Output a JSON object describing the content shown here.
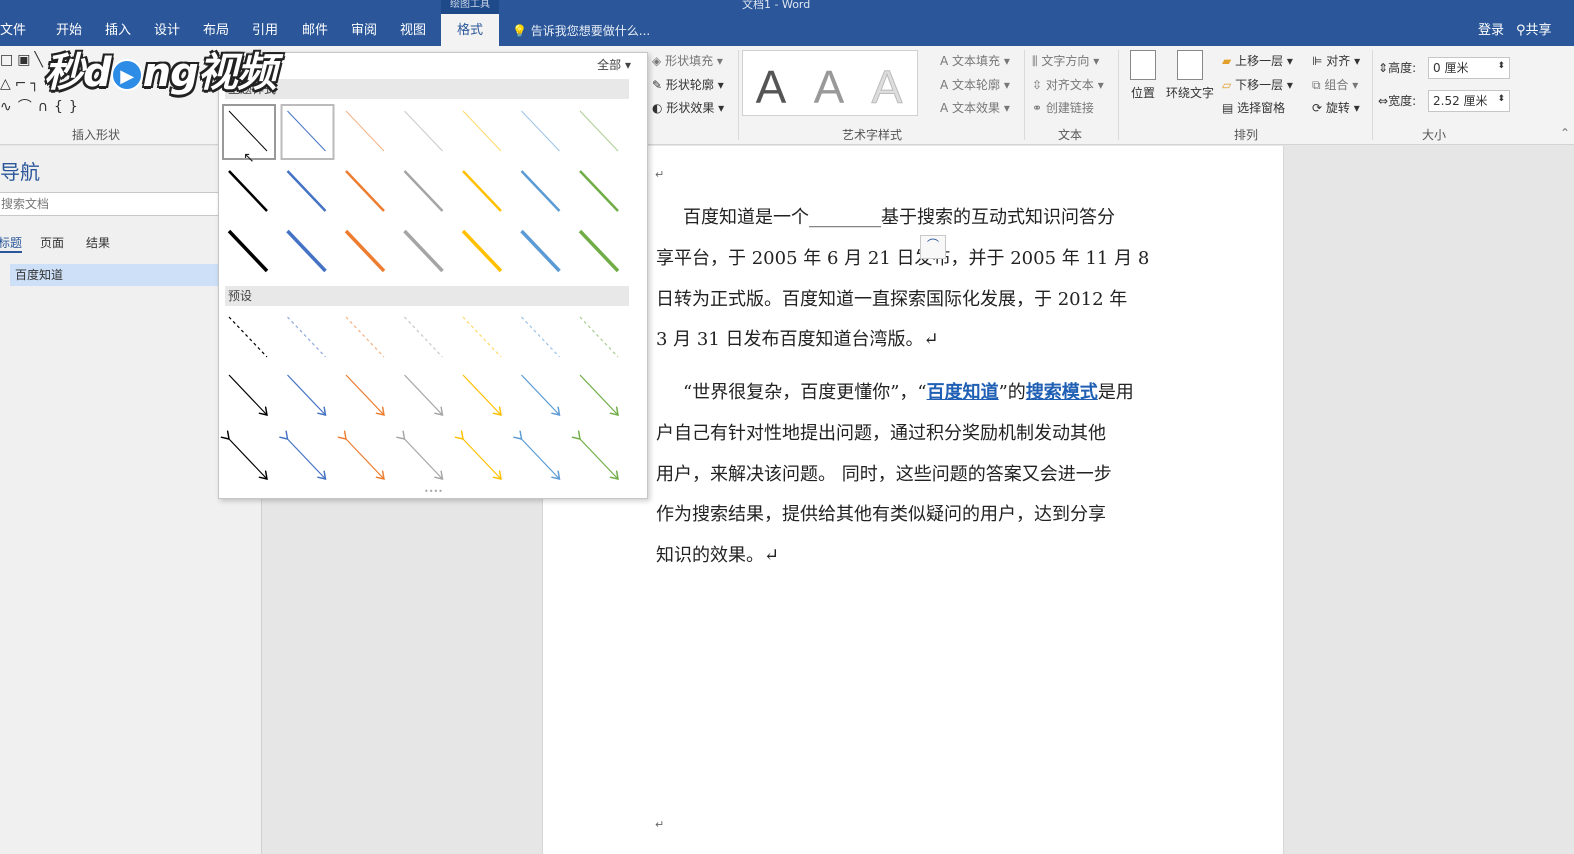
{
  "window": {
    "title": "文档1 - Word",
    "context_tab_group": "绘图工具"
  },
  "menu": {
    "tabs": [
      "文件",
      "开始",
      "插入",
      "设计",
      "布局",
      "引用",
      "邮件",
      "审阅",
      "视图",
      "格式"
    ],
    "active_tab": "格式",
    "tell_me": "告诉我您想要做什么...",
    "login": "登录",
    "share": "共享"
  },
  "ribbon": {
    "insert_shapes_label": "插入形状",
    "shape_fill": "形状填充",
    "shape_outline": "形状轮廓",
    "shape_effects": "形状效果",
    "wordart_label": "艺术字样式",
    "wordart_letter": "A",
    "text_fill": "文本填充",
    "text_outline": "文本轮廓",
    "text_effects": "文本效果",
    "text_direction": "文字方向",
    "align_text": "对齐文本",
    "create_link": "创建链接",
    "text_label": "文本",
    "position": "位置",
    "wrap_text": "环绕文字",
    "bring_forward": "上移一层",
    "send_backward": "下移一层",
    "selection_pane": "选择窗格",
    "align": "对齐",
    "group": "组合",
    "rotate": "旋转",
    "arrange_label": "排列",
    "height_label": "高度:",
    "height_value": "0 厘米",
    "width_label": "宽度:",
    "width_value": "2.52 厘米",
    "size_label": "大小"
  },
  "navigation": {
    "title": "导航",
    "search_placeholder": "搜索文档",
    "tabs": [
      "标题",
      "页面",
      "结果"
    ],
    "items": [
      "百度知道"
    ]
  },
  "dropdown": {
    "filter": "全部",
    "section_theme": "主题样式",
    "section_preset": "预设",
    "colors": [
      "#000000",
      "#4472c4",
      "#ed7d31",
      "#a5a5a5",
      "#ffc000",
      "#5b9bd5",
      "#70ad47"
    ]
  },
  "document": {
    "paragraph1": [
      "百度知道是一个________基于搜索的互动式知识问答分",
      "享平台，于 2005 年 6 月 21 日发布，并于 2005 年 11 月 8",
      "日转为正式版。百度知道一直探索国际化发展，于 2012 年",
      "3 月 31 日发布百度知道台湾版。↵"
    ],
    "paragraph2_pre": "“世界很复杂，百度更懂你”，“",
    "link1": "百度知道",
    "paragraph2_mid": "”的",
    "link2": "搜索模式",
    "paragraph2_post": "是用",
    "paragraph2_rest": [
      "户自己有针对性地提出问题，通过积分奖励机制发动其他",
      "用户，来解决该问题。 同时，这些问题的答案又会进一步",
      "作为搜索结果，提供给其他有类似疑问的用户，达到分享",
      "知识的效果。↵"
    ],
    "paragraph_mark": "↵"
  },
  "watermark": {
    "text_a": "秒d",
    "text_b": "ng视频"
  }
}
